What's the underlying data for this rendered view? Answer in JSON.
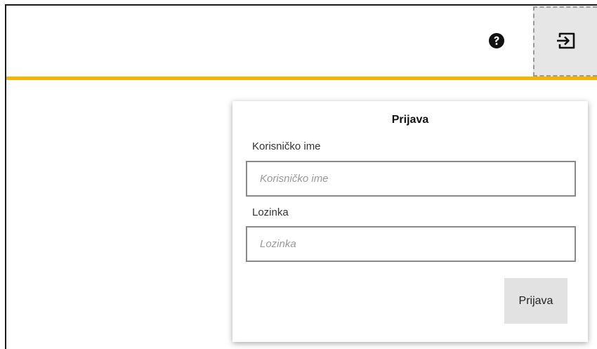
{
  "colors": {
    "accent": "#f5b400",
    "login_button_bg": "#e6e6e6"
  },
  "header": {
    "help_icon": "question-circle",
    "login_icon": "sign-in"
  },
  "login_form": {
    "title": "Prijava",
    "username": {
      "label": "Korisničko ime",
      "placeholder": "Korisničko ime",
      "value": ""
    },
    "password": {
      "label": "Lozinka",
      "placeholder": "Lozinka",
      "value": ""
    },
    "submit_label": "Prijava"
  }
}
